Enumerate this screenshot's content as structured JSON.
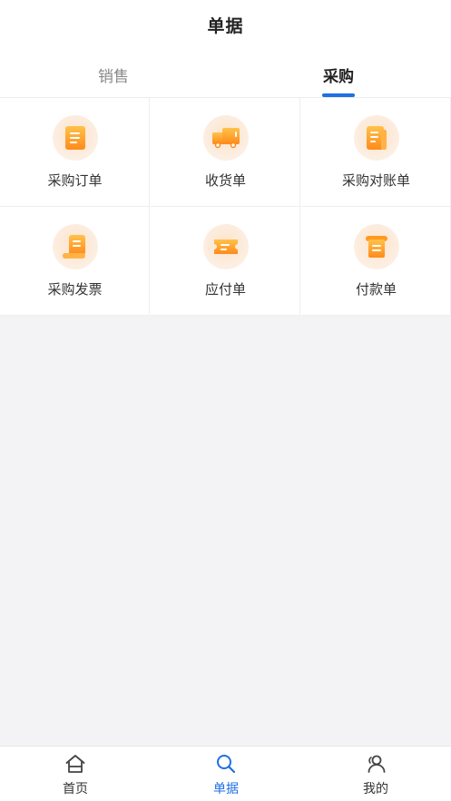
{
  "header": {
    "title": "单据"
  },
  "tabs": [
    {
      "label": "销售",
      "active": false
    },
    {
      "label": "采购",
      "active": true
    }
  ],
  "grid": {
    "items": [
      {
        "label": "采购订单",
        "icon": "purchase-order-icon"
      },
      {
        "label": "收货单",
        "icon": "delivery-truck-icon"
      },
      {
        "label": "采购对账单",
        "icon": "reconciliation-icon"
      },
      {
        "label": "采购发票",
        "icon": "invoice-scroll-icon"
      },
      {
        "label": "应付单",
        "icon": "payable-ticket-icon"
      },
      {
        "label": "付款单",
        "icon": "payment-scroll-icon"
      }
    ]
  },
  "bottom_nav": {
    "items": [
      {
        "label": "首页",
        "icon": "home-icon",
        "active": false
      },
      {
        "label": "单据",
        "icon": "search-icon",
        "active": true
      },
      {
        "label": "我的",
        "icon": "profile-icon",
        "active": false
      }
    ]
  },
  "colors": {
    "accent": "#1f6fe5",
    "icon_orange": "#ff9a1e",
    "icon_bg": "#fce8d6"
  }
}
